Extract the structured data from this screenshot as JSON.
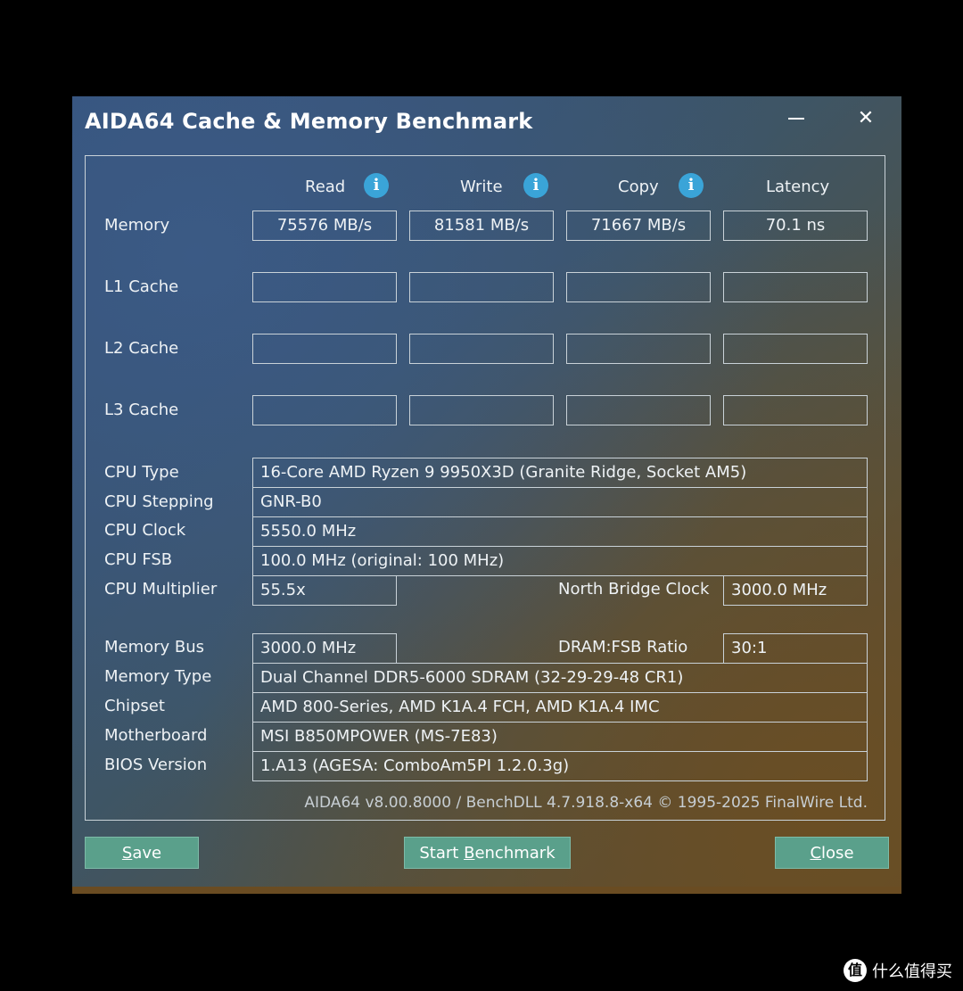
{
  "window": {
    "title": "AIDA64 Cache & Memory Benchmark"
  },
  "headers": {
    "read": "Read",
    "write": "Write",
    "copy": "Copy",
    "latency": "Latency"
  },
  "rows": {
    "memory": {
      "label": "Memory",
      "read": "75576 MB/s",
      "write": "81581 MB/s",
      "copy": "71667 MB/s",
      "latency": "70.1 ns"
    },
    "l1": {
      "label": "L1 Cache",
      "read": "",
      "write": "",
      "copy": "",
      "latency": ""
    },
    "l2": {
      "label": "L2 Cache",
      "read": "",
      "write": "",
      "copy": "",
      "latency": ""
    },
    "l3": {
      "label": "L3 Cache",
      "read": "",
      "write": "",
      "copy": "",
      "latency": ""
    }
  },
  "info": {
    "cpu_type": {
      "label": "CPU Type",
      "value": "16-Core AMD Ryzen 9 9950X3D  (Granite Ridge, Socket AM5)"
    },
    "cpu_stepping": {
      "label": "CPU Stepping",
      "value": "GNR-B0"
    },
    "cpu_clock": {
      "label": "CPU Clock",
      "value": "5550.0 MHz"
    },
    "cpu_fsb": {
      "label": "CPU FSB",
      "value": "100.0 MHz  (original: 100 MHz)"
    },
    "cpu_multiplier": {
      "label": "CPU Multiplier",
      "value": "55.5x"
    },
    "nb_clock": {
      "label": "North Bridge Clock",
      "value": "3000.0 MHz"
    },
    "memory_bus": {
      "label": "Memory Bus",
      "value": "3000.0 MHz"
    },
    "dram_fsb": {
      "label": "DRAM:FSB Ratio",
      "value": "30:1"
    },
    "memory_type": {
      "label": "Memory Type",
      "value": "Dual Channel DDR5-6000 SDRAM  (32-29-29-48 CR1)"
    },
    "chipset": {
      "label": "Chipset",
      "value": "AMD 800-Series, AMD K1A.4 FCH, AMD K1A.4 IMC"
    },
    "motherboard": {
      "label": "Motherboard",
      "value": "MSI B850MPOWER (MS-7E83)"
    },
    "bios": {
      "label": "BIOS Version",
      "value": "1.A13  (AGESA: ComboAm5PI 1.2.0.3g)"
    }
  },
  "footer": "AIDA64 v8.00.8000 / BenchDLL 4.7.918.8-x64 © 1995-2025 FinalWire Ltd.",
  "buttons": {
    "save_first": "S",
    "save_rest": "ave",
    "start_a": "Start ",
    "start_b": "B",
    "start_c": "enchmark",
    "close_first": "C",
    "close_rest": "lose"
  },
  "icons": {
    "info": "info-icon",
    "minimize": "minimize-icon",
    "close": "close-icon"
  },
  "watermark": {
    "icon_text": "值",
    "text": "什么值得买"
  },
  "colors": {
    "button": "#5aa08b",
    "info": "#3aa4d8"
  }
}
